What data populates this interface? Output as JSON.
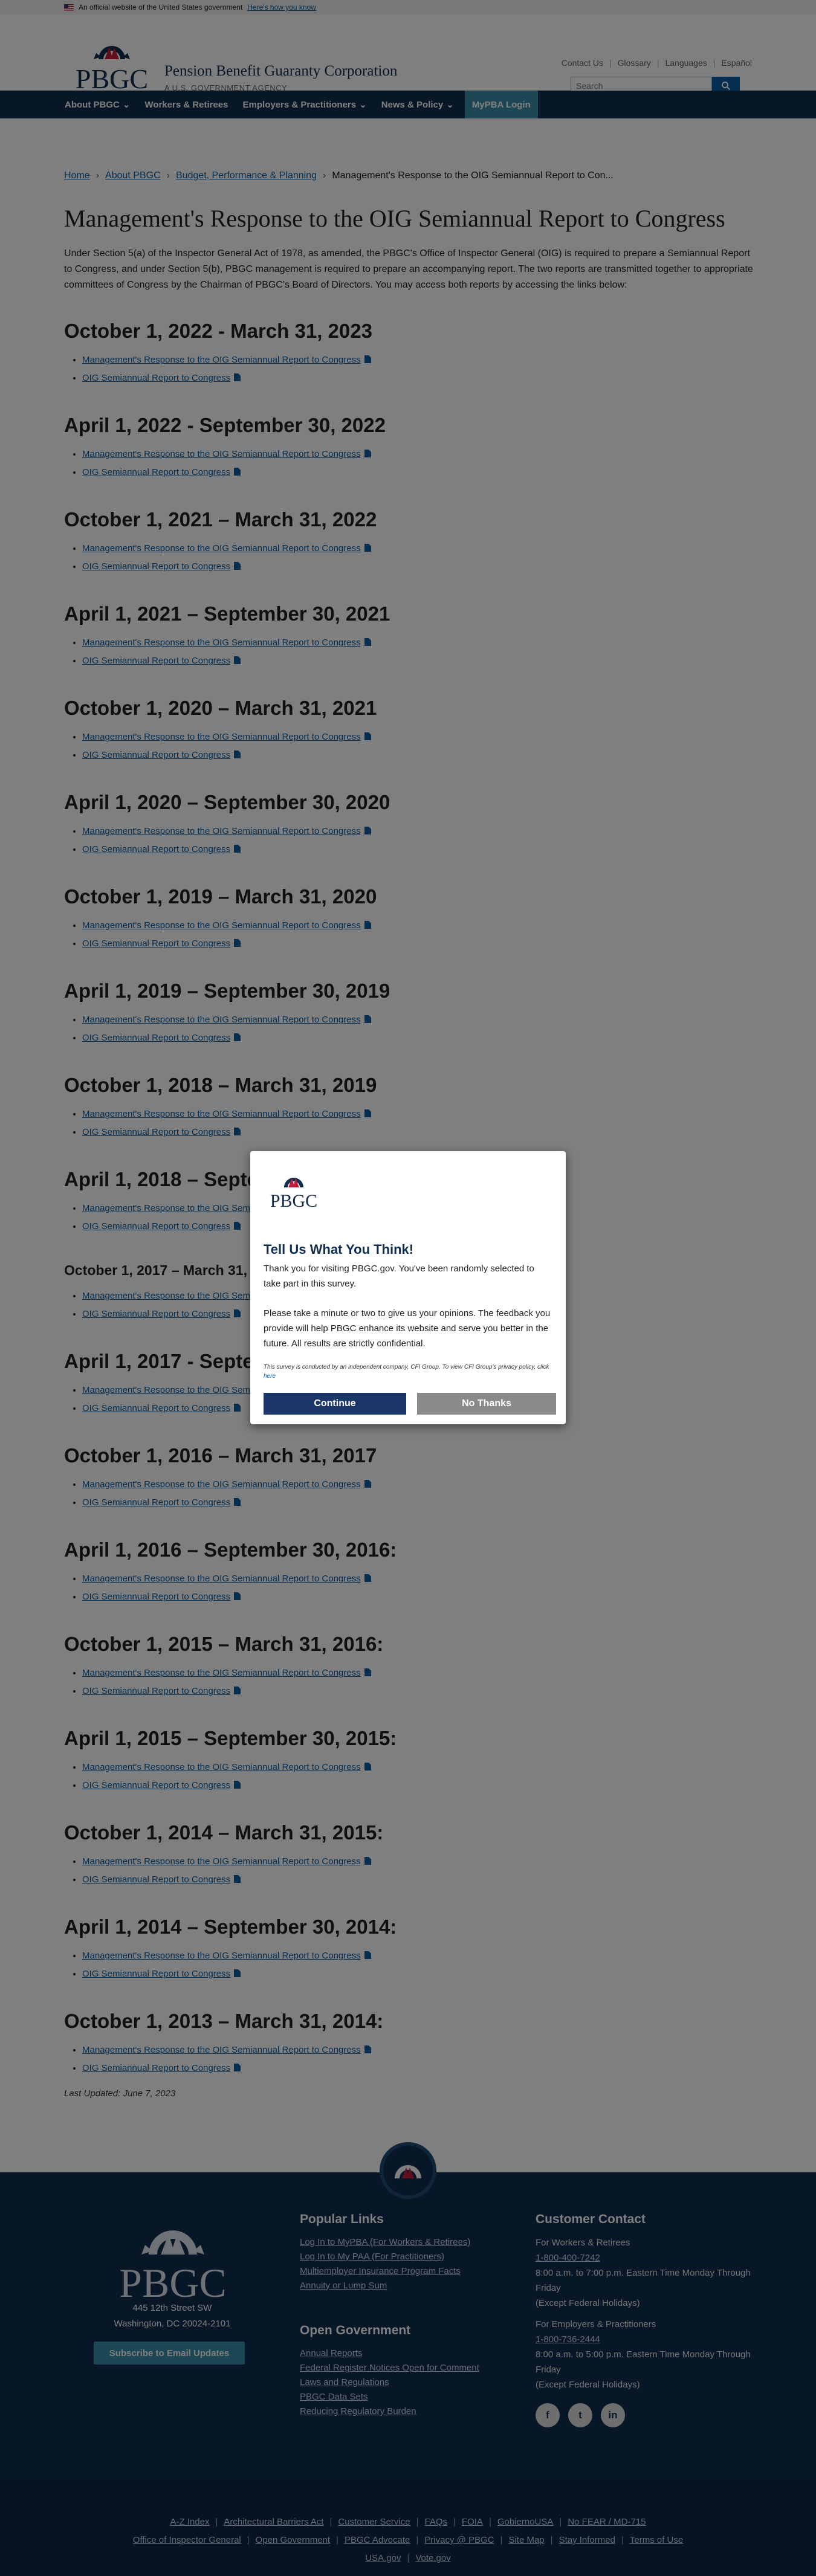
{
  "gov_banner": {
    "text": "An official website of the United States government",
    "link": "Here's how you know"
  },
  "header": {
    "logo_text": "PBGC",
    "agency_name": "Pension Benefit Guaranty Corporation",
    "agency_sub": "A U.S. GOVERNMENT AGENCY",
    "util_links": [
      "Contact Us",
      "Glossary",
      "Languages",
      "Español"
    ],
    "search_placeholder": "Search"
  },
  "nav": {
    "items": [
      "About PBGC",
      "Workers & Retirees",
      "Employers & Practitioners",
      "News & Policy"
    ],
    "mypba": "MyPBA Login"
  },
  "breadcrumb": [
    "Home",
    "About PBGC",
    "Budget, Performance & Planning",
    "Management's Response to the OIG Semiannual Report to Con..."
  ],
  "page_title": "Management's Response to the OIG Semiannual Report to Congress",
  "intro": "Under Section 5(a) of the Inspector General Act of 1978, as amended, the PBGC's Office of Inspector General (OIG) is required to prepare a Semiannual Report to Congress, and under Section 5(b), PBGC management is required to prepare an accompanying report. The two reports are transmitted together to appropriate committees of Congress by the Chairman of PBGC's Board of Directors. You may access both reports by accessing the links below:",
  "link_labels": {
    "management": "Management's Response to the OIG Semiannual Report to Congress",
    "oig": "OIG Semiannual Report to Congress"
  },
  "periods": [
    "October 1, 2022 - March 31, 2023",
    "April 1, 2022 - September 30, 2022",
    "October 1, 2021 – March 31, 2022",
    "April 1, 2021 – September 30, 2021",
    "October 1, 2020 – March 31, 2021",
    "April 1, 2020 – September 30, 2020",
    "October 1, 2019 – March 31, 2020",
    "April 1, 2019 – September 30, 2019",
    "October 1, 2018 – March 31, 2019",
    "April 1, 2018 – September 30, 2018",
    "October 1, 2017 – March 31, 2018",
    "April 1, 2017 - September 30, 2017",
    "October 1, 2016 – March 31, 2017",
    "April 1, 2016 – September 30, 2016:",
    "October 1, 2015 – March 31, 2016:",
    "April 1, 2015 – September 30, 2015:",
    "October 1, 2014 – March 31, 2015:",
    "April 1, 2014 – September 30, 2014:",
    "October 1, 2013 – March 31, 2014:"
  ],
  "last_updated": "Last Updated: June 7, 2023",
  "footer": {
    "logo_text": "PBGC",
    "address_line1": "445 12th Street SW",
    "address_line2": "Washington, DC 20024-2101",
    "email_button": "Subscribe to Email Updates",
    "popular_title": "Popular Links",
    "popular_links": [
      "Log In to MyPBA (For Workers & Retirees)",
      "Log In to My PAA (For Practitioners)",
      "Multiemployer Insurance Program Facts",
      "Annuity or Lump Sum"
    ],
    "open_gov_title": "Open Government",
    "open_gov_links": [
      "Annual Reports",
      "Federal Register Notices Open for Comment",
      "Laws and Regulations",
      "PBGC Data Sets",
      "Reducing Regulatory Burden"
    ],
    "contact_title": "Customer Contact",
    "workers_label": "For Workers & Retirees",
    "workers_phone": "1-800-400-7242",
    "workers_hours": "8:00 a.m. to 7:00 p.m. Eastern Time Monday Through Friday",
    "workers_except": "(Except Federal Holidays)",
    "employers_label": "For Employers & Practitioners",
    "employers_phone": "1-800-736-2444",
    "employers_hours": "8:00 a.m. to 5:00 p.m. Eastern Time Monday Through Friday",
    "employers_except": "(Except Federal Holidays)",
    "social": [
      "f",
      "t",
      "in"
    ],
    "bottom_row1": [
      "A-Z Index",
      "Architectural Barriers Act",
      "Customer Service",
      "FAQs",
      "FOIA",
      "GobiernoUSA",
      "No FEAR / MD-715"
    ],
    "bottom_row2": [
      "Office of Inspector General",
      "Open Government",
      "PBGC Advocate",
      "Privacy @ PBGC",
      "Site Map",
      "Stay Informed",
      "Terms of Use"
    ],
    "bottom_row3": [
      "USA.gov",
      "Vote.gov"
    ]
  },
  "survey": {
    "logo_text": "PBGC",
    "title": "Tell Us What You Think!",
    "para1": "Thank you for visiting PBGC.gov. You've been randomly selected to take part in this survey.",
    "para2": "Please take a minute or two to give us your opinions. The feedback you provide will help PBGC enhance its website and serve you better in the future. All results are strictly confidential.",
    "small": "This survey is conducted by an independent company, CFI Group. To view CFI Group's privacy policy, click",
    "small_link": "here",
    "continue": "Continue",
    "no_thanks": "No Thanks"
  },
  "colors": {
    "navy": "#112e51",
    "link": "#0b5fa5",
    "accent_teal": "#3a8fa8",
    "logo_red": "#c41e3a"
  }
}
